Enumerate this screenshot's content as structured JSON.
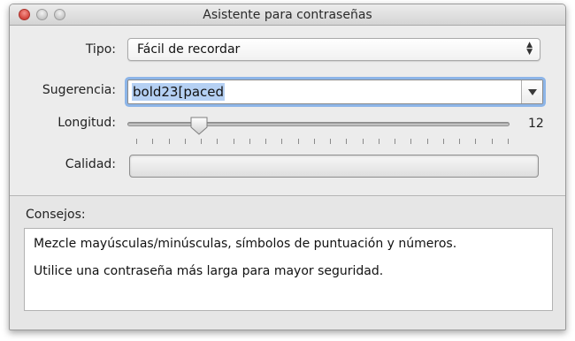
{
  "window": {
    "title": "Asistente para contraseñas"
  },
  "form": {
    "tipo": {
      "label": "Tipo:",
      "value": "Fácil de recordar"
    },
    "sugerencia": {
      "label": "Sugerencia:",
      "value": "bold23[paced"
    },
    "longitud": {
      "label": "Longitud:",
      "value": "12",
      "min": 8,
      "max": 31,
      "current": 12
    },
    "calidad": {
      "label": "Calidad:",
      "level": 0
    }
  },
  "consejos": {
    "label": "Consejos:",
    "tips": [
      "Mezcle mayúsculas/minúsculas, símbolos de puntuación y números.",
      "Utilice una contraseña más larga para mayor seguridad."
    ]
  },
  "colors": {
    "focus_ring": "#8db5e8",
    "selection": "#b5d0f3",
    "close": "#d2443c"
  },
  "icons": [
    "close-icon",
    "minimize-icon",
    "zoom-icon",
    "updown-arrows-icon",
    "dropdown-arrow-icon",
    "slider-knob-icon"
  ]
}
